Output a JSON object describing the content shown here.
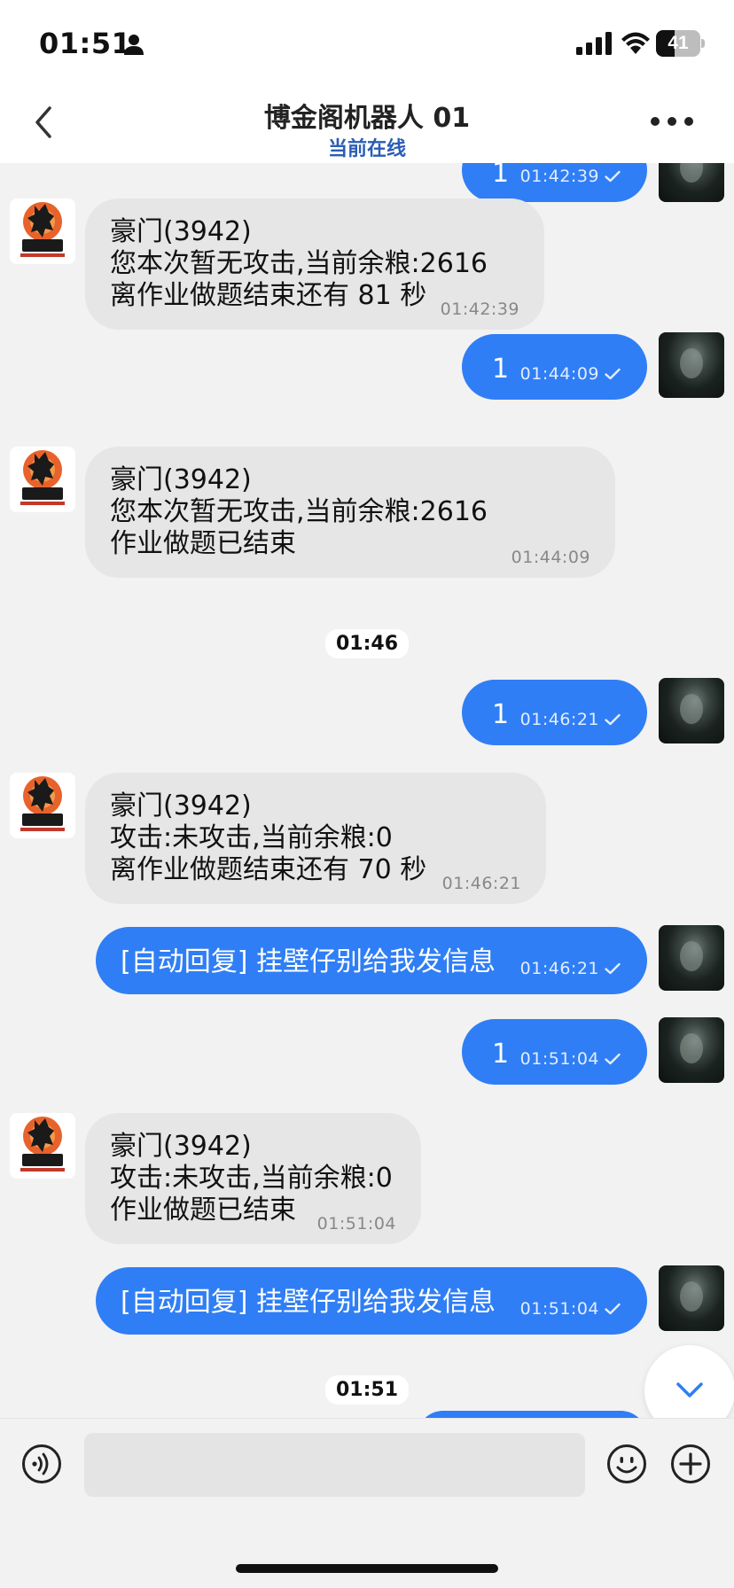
{
  "status_bar": {
    "time": "01:51",
    "battery": "41",
    "battery_level": 0.41
  },
  "nav": {
    "title": "博金阁机器人 01",
    "subtitle": "当前在线"
  },
  "messages": [
    {
      "kind": "out",
      "text": "1",
      "time": "01:42:39"
    },
    {
      "kind": "in",
      "lines": [
        "豪门(3942)",
        "您本次暂无攻击,当前余粮:2616",
        "离作业做题结束还有 81 秒"
      ],
      "time": "01:42:39"
    },
    {
      "kind": "out",
      "text": "1",
      "time": "01:44:09"
    },
    {
      "kind": "in",
      "lines": [
        "豪门(3942)",
        "您本次暂无攻击,当前余粮:2616",
        "作业做题已结束"
      ],
      "time": "01:44:09"
    },
    {
      "kind": "sep",
      "text": "01:46"
    },
    {
      "kind": "out",
      "text": "1",
      "time": "01:46:21"
    },
    {
      "kind": "in",
      "lines": [
        "豪门(3942)",
        "攻击:未攻击,当前余粮:0",
        "离作业做题结束还有 70 秒"
      ],
      "time": "01:46:21"
    },
    {
      "kind": "out",
      "text": "[自动回复] 挂壁仔别给我发信息",
      "time": "01:46:21"
    },
    {
      "kind": "out",
      "text": "1",
      "time": "01:51:04"
    },
    {
      "kind": "in",
      "lines": [
        "豪门(3942)",
        "攻击:未攻击,当前余粮:0",
        "作业做题已结束"
      ],
      "time": "01:51:04"
    },
    {
      "kind": "out",
      "text": "[自动回复] 挂壁仔别给我发信息",
      "time": "01:51:04"
    },
    {
      "kind": "sep",
      "text": "01:51"
    }
  ],
  "colors": {
    "outgoing_bubble": "#2f7ef5",
    "incoming_bubble": "#e6e6e6",
    "subtitle": "#2a5db5",
    "background": "#f2f2f2"
  },
  "icons": {
    "back": "chevron-left-icon",
    "more": "more-icon",
    "voice": "voice-icon",
    "emoji": "emoji-icon",
    "plus": "plus-icon",
    "scroll_down": "chevron-down-icon",
    "read_check": "check-icon",
    "person": "person-icon"
  }
}
